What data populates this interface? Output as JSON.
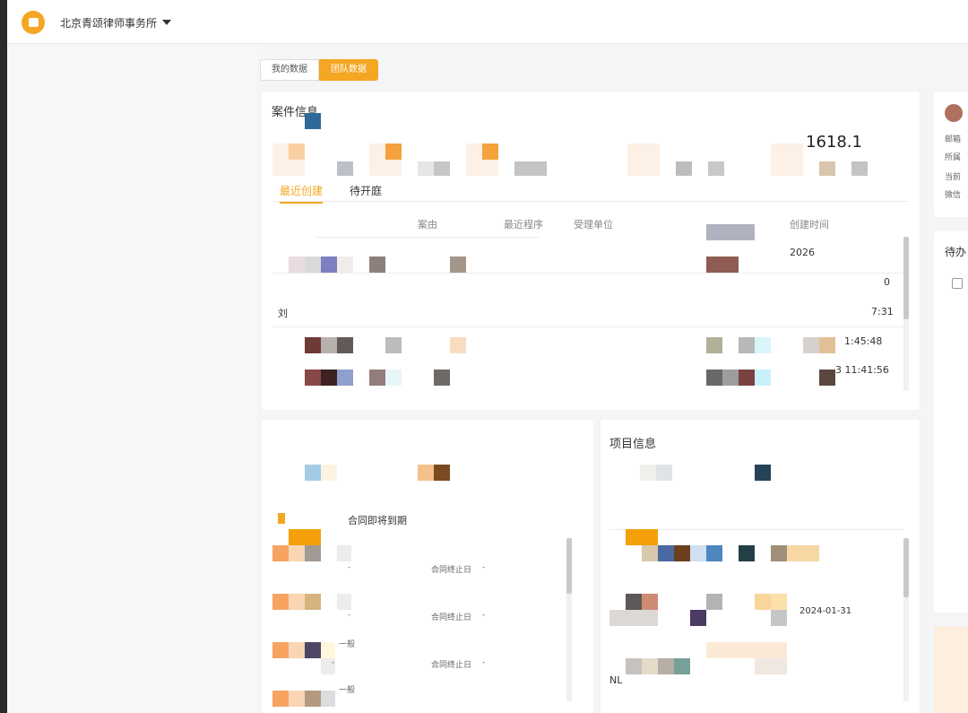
{
  "header": {
    "org_name": "北京青颂律师事务所"
  },
  "view_tabs": [
    {
      "label": "我的数据",
      "active": false
    },
    {
      "label": "团队数据",
      "active": true
    }
  ],
  "case_info": {
    "title": "案件信息",
    "big_number": "1618.1",
    "subtabs": [
      {
        "label": "最近创建",
        "active": true
      },
      {
        "label": "待开庭",
        "active": false
      }
    ],
    "columns": [
      "案由",
      "最近程序",
      "受理单位",
      "创建时间"
    ],
    "rows": [
      {
        "name": "",
        "time": "2026"
      },
      {
        "name": "",
        "time": "0"
      },
      {
        "name": "刘",
        "time": "7:31"
      },
      {
        "name": "",
        "time": "1:45:48"
      },
      {
        "name": "",
        "time": "3 11:41:56"
      }
    ]
  },
  "contract_info": {
    "subtitle": "合同即将到期",
    "end_date_label": "合同终止日",
    "end_date_value": "-",
    "dash": "-",
    "level_label": "一般"
  },
  "project_info": {
    "title": "项目信息",
    "date1": "2024-01-31",
    "row_prefix": "NL"
  },
  "right_panel": {
    "labels": [
      "邮箱",
      "所属",
      "当前",
      "微信"
    ],
    "todo_title": "待办"
  },
  "colors": {
    "accent": "#f5a623",
    "background": "#f4f5f7"
  }
}
